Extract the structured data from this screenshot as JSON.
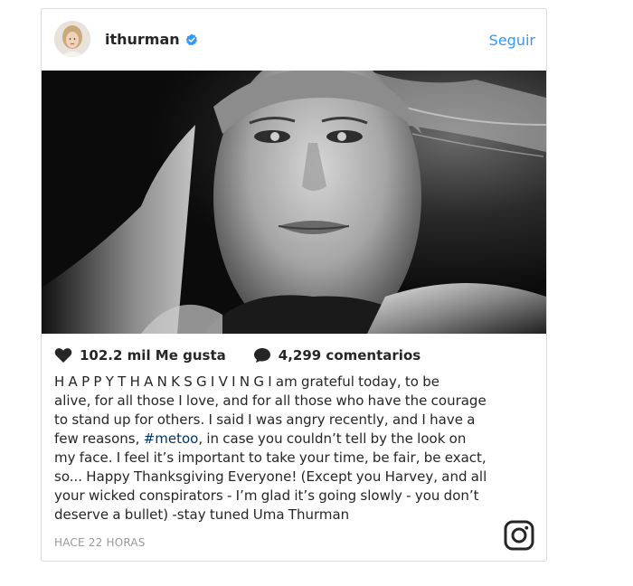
{
  "post": {
    "username": "ithurman",
    "follow_label": "Seguir",
    "likes": "102.2 mil Me gusta",
    "comments": "4,299 comentarios",
    "caption_lines": [
      "H A P P Y T H A N K S G I V I N G I am grateful today, to be",
      "alive, for all those I love, and for all those who have the courage",
      "to stand up for others. I said I was angry recently, and I have a",
      "few reasons, ",
      "#metoo",
      ", in case you couldn’t tell by the look on",
      "my face. I feel it’s important to take your time, be fair, be exact,",
      "so... Happy Thanksgiving Everyone! (Except you Harvey, and all",
      "your wicked conspirators - I’m glad it’s going slowly - you don’t",
      "deserve a bullet) -stay tuned Uma Thurman"
    ],
    "timestamp": "HACE 22 HORAS"
  },
  "icons": {
    "verified": "verified-badge-icon",
    "heart": "heart-icon",
    "comment": "comment-icon",
    "instagram": "instagram-logo-icon"
  },
  "colors": {
    "link": "#3897f0",
    "text": "#262626",
    "muted": "#999999",
    "border": "#dbdbdb",
    "hashtag": "#003569"
  }
}
